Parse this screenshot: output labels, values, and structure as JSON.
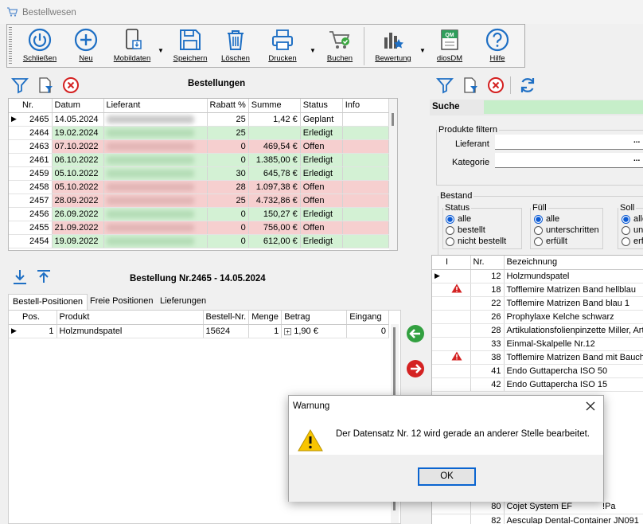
{
  "window": {
    "title": "Bestellwesen"
  },
  "toolbar": {
    "buttons": [
      {
        "label": "Schließen",
        "icon": "power-icon"
      },
      {
        "label": "Neu",
        "icon": "plus-circle-icon"
      },
      {
        "label": "Mobildaten",
        "icon": "tablet-icon"
      },
      {
        "label": "Speichern",
        "icon": "floppy-icon"
      },
      {
        "label": "Löschen",
        "icon": "trash-icon"
      },
      {
        "label": "Drucken",
        "icon": "printer-icon"
      },
      {
        "label": "Buchen",
        "icon": "cart-icon"
      },
      {
        "label": "Bewertung",
        "icon": "rating-chart-icon"
      },
      {
        "label": "diosDM",
        "icon": "qm-icon"
      },
      {
        "label": "Hilfe",
        "icon": "help-icon"
      }
    ],
    "qm_text": "QM"
  },
  "orders": {
    "title": "Bestellungen",
    "columns": [
      "Nr.",
      "Datum",
      "Lieferant",
      "Rabatt %",
      "Summe",
      "Status",
      "Info"
    ],
    "rows": [
      {
        "nr": "2465",
        "datum": "14.05.2024",
        "rabatt": "25",
        "summe": "1,42 €",
        "status": "Geplant",
        "state": "white"
      },
      {
        "nr": "2464",
        "datum": "19.02.2024",
        "rabatt": "25",
        "summe": "",
        "status": "Erledigt",
        "state": "green"
      },
      {
        "nr": "2463",
        "datum": "07.10.2022",
        "rabatt": "0",
        "summe": "469,54 €",
        "status": "Offen",
        "state": "red"
      },
      {
        "nr": "2461",
        "datum": "06.10.2022",
        "rabatt": "0",
        "summe": "1.385,00 €",
        "status": "Erledigt",
        "state": "green"
      },
      {
        "nr": "2459",
        "datum": "05.10.2022",
        "rabatt": "30",
        "summe": "645,78 €",
        "status": "Erledigt",
        "state": "green"
      },
      {
        "nr": "2458",
        "datum": "05.10.2022",
        "rabatt": "28",
        "summe": "1.097,38 €",
        "status": "Offen",
        "state": "red"
      },
      {
        "nr": "2457",
        "datum": "28.09.2022",
        "rabatt": "25",
        "summe": "4.732,86 €",
        "status": "Offen",
        "state": "red"
      },
      {
        "nr": "2456",
        "datum": "26.09.2022",
        "rabatt": "0",
        "summe": "150,27 €",
        "status": "Erledigt",
        "state": "green"
      },
      {
        "nr": "2455",
        "datum": "21.09.2022",
        "rabatt": "0",
        "summe": "756,00 €",
        "status": "Offen",
        "state": "red"
      },
      {
        "nr": "2454",
        "datum": "19.09.2022",
        "rabatt": "0",
        "summe": "612,00 €",
        "status": "Erledigt",
        "state": "green"
      }
    ]
  },
  "detail": {
    "title": "Bestellung Nr.2465 - 14.05.2024",
    "tabs": [
      "Bestell-Positionen",
      "Freie Positionen",
      "Lieferungen"
    ],
    "columns": [
      "Pos.",
      "Produkt",
      "Bestell-Nr.",
      "Menge",
      "Betrag",
      "Eingang"
    ],
    "rows": [
      {
        "pos": "1",
        "produkt": "Holzmundspatel",
        "bestellnr": "15624",
        "menge": "1",
        "betrag": "1,90 €",
        "eingang": "0"
      }
    ]
  },
  "search": {
    "label": "Suche",
    "filter_legend": "Produkte filtern",
    "lieferant_label": "Lieferant",
    "kategorie_label": "Kategorie",
    "dots": "...",
    "bestand": {
      "legend": "Bestand",
      "status": {
        "legend": "Status",
        "options": [
          "alle",
          "bestellt",
          "nicht bestellt"
        ]
      },
      "fuell": {
        "legend": "Füll",
        "options": [
          "alle",
          "unterschritten",
          "erfüllt"
        ]
      },
      "soll": {
        "legend": "Soll",
        "options": [
          "alle",
          "unterschritten",
          "erfüllt"
        ]
      }
    }
  },
  "products": {
    "columns": [
      "I",
      "Nr.",
      "Bezeichnung"
    ],
    "rows": [
      {
        "nr": "12",
        "name": "Holzmundspatel",
        "warn": false
      },
      {
        "nr": "18",
        "name": "Tofflemire Matrizen Band hellblau",
        "warn": true
      },
      {
        "nr": "22",
        "name": "Tofflemire Matrizen Band blau 1",
        "warn": false
      },
      {
        "nr": "26",
        "name": "Prophylaxe Kelche schwarz",
        "warn": false
      },
      {
        "nr": "28",
        "name": "Artikulationsfolienpinzette Miller, Artic",
        "warn": false
      },
      {
        "nr": "33",
        "name": "Einmal-Skalpelle Nr.12",
        "warn": false
      },
      {
        "nr": "38",
        "name": "Tofflemire Matrizen Band mit Bauch",
        "warn": true
      },
      {
        "nr": "41",
        "name": "Endo Guttapercha ISO 50",
        "warn": false
      },
      {
        "nr": "42",
        "name": "Endo Guttapercha ISO 15",
        "warn": false
      }
    ],
    "rows_bottom": [
      {
        "nr": "80",
        "name": "Cojet System EF",
        "extra": "!Pa"
      },
      {
        "nr": "82",
        "name": "Aesculap Dental-Container JN091",
        "extra": ""
      }
    ]
  },
  "dialog": {
    "title": "Warnung",
    "message": "Der Datensatz Nr. 12 wird gerade an anderer Stelle bearbeitet.",
    "ok": "OK"
  }
}
